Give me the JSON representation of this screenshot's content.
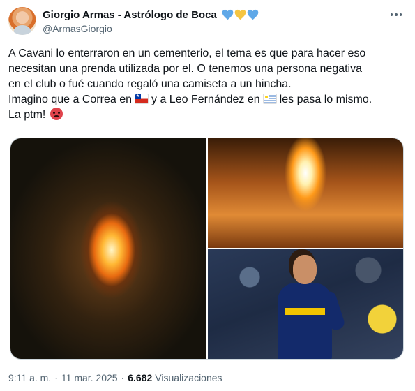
{
  "author": {
    "display_name": "Giorgio Armas - Astrólogo de Boca",
    "handle": "@ArmasGiorgio",
    "badge_hearts": [
      "#5fa8e8",
      "#f5c542",
      "#5fa8e8"
    ]
  },
  "tweet": {
    "lines": [
      "A Cavani lo enterraron en un cementerio, el tema es que para hacer eso",
      "necesitan una prenda utilizada por el. O tenemos una persona negativa",
      "en el club o fué cuando regaló una camiseta a un hincha.",
      "Imagino que a Correa en",
      "y a Leo Fernández en",
      "les pasa lo mismo.",
      "La ptm!"
    ],
    "flags": [
      "chile-flag-icon",
      "uruguay-flag-icon"
    ],
    "emoji": "angry-face-icon"
  },
  "media": [
    "burning-shirt-photo",
    "flames-photo",
    "player-celebrating-photo"
  ],
  "meta": {
    "time": "9:11 a. m.",
    "separator": "·",
    "date": "11 mar. 2025",
    "views_count": "6.682",
    "views_label": "Visualizaciones"
  }
}
